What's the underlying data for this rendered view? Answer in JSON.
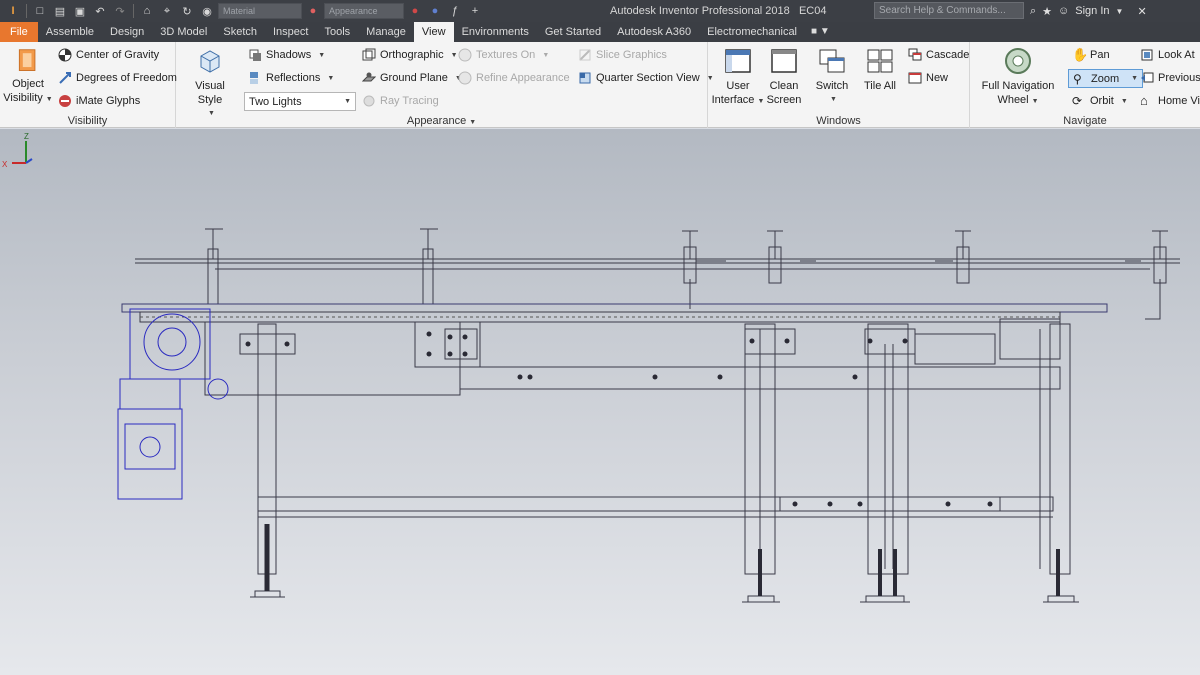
{
  "title_bar": {
    "app_title": "Autodesk Inventor Professional 2018",
    "document": "EC04",
    "material_placeholder": "Material",
    "appearance_placeholder": "Appearance",
    "search_placeholder": "Search Help & Commands...",
    "sign_in": "Sign In"
  },
  "tabs": [
    "File",
    "Assemble",
    "Design",
    "3D Model",
    "Sketch",
    "Inspect",
    "Tools",
    "Manage",
    "View",
    "Environments",
    "Get Started",
    "Autodesk A360",
    "Electromechanical"
  ],
  "active_tab": "View",
  "panels": {
    "visibility": {
      "title": "Visibility",
      "object_visibility": [
        "Object",
        "Visibility"
      ],
      "center_of_gravity": "Center of Gravity",
      "degrees_of_freedom": "Degrees of Freedom",
      "imate_glyphs": "iMate Glyphs"
    },
    "appearance": {
      "title": "Appearance",
      "visual_style": "Visual Style",
      "shadows": "Shadows",
      "reflections": "Reflections",
      "lighting": "Two Lights",
      "orthographic": "Orthographic",
      "ground_plane": "Ground Plane",
      "ray_tracing": "Ray Tracing",
      "textures_on": "Textures On",
      "refine_appearance": "Refine Appearance",
      "slice_graphics": "Slice Graphics",
      "quarter_section": "Quarter Section View"
    },
    "windows": {
      "title": "Windows",
      "user_interface": [
        "User",
        "Interface"
      ],
      "clean_screen": [
        "Clean",
        "Screen"
      ],
      "switch": "Switch",
      "tile_all": "Tile All",
      "cascade": "Cascade",
      "new": "New"
    },
    "navigate": {
      "title": "Navigate",
      "full_nav_wheel": [
        "Full Navigation",
        "Wheel"
      ],
      "pan": "Pan",
      "zoom": "Zoom",
      "orbit": "Orbit",
      "look_at": "Look At",
      "previous": "Previous",
      "home_view": "Home View"
    }
  },
  "triad": {
    "x": "X",
    "z": "Z"
  },
  "colors": {
    "file_tab": "#e8772e",
    "highlight": "#cfe3f7",
    "model_line": "#3a3a48",
    "gearbox": "#2a2ac0"
  }
}
